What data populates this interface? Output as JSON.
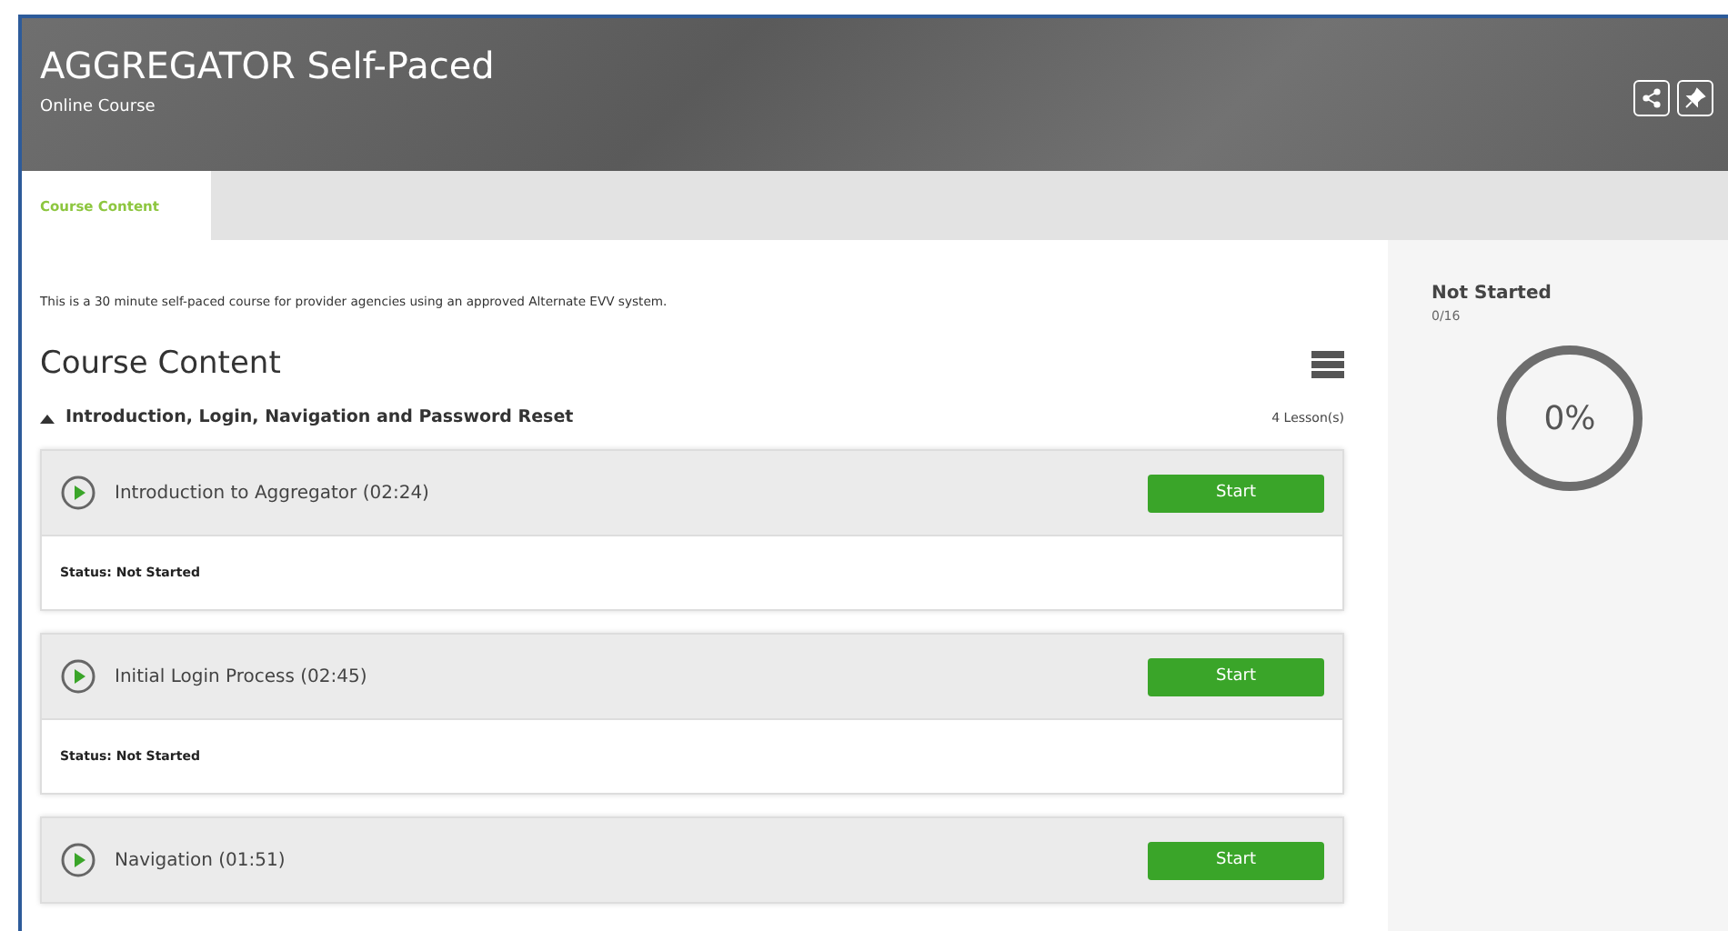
{
  "header": {
    "title": "AGGREGATOR Self-Paced",
    "subtitle": "Online Course"
  },
  "tabs": [
    {
      "label": "Course Content",
      "selected": true
    }
  ],
  "description": "This is a 30 minute self-paced course for provider agencies using an approved Alternate EVV system.",
  "content_title": "Course Content",
  "section": {
    "title": "Introduction, Login, Navigation and Password Reset",
    "expanded": true,
    "count": "4 Lesson(s)",
    "lessons": [
      {
        "title": "Introduction to Aggregator (02:24)",
        "button": "Start",
        "status": "Status: Not Started"
      },
      {
        "title": "Initial Login Process (02:45)",
        "button": "Start",
        "status": "Status: Not Started"
      },
      {
        "title": "Navigation (01:51)",
        "button": "Start"
      }
    ]
  },
  "progress": {
    "status": "Not Started",
    "count": "0/16",
    "percent": "0%"
  }
}
